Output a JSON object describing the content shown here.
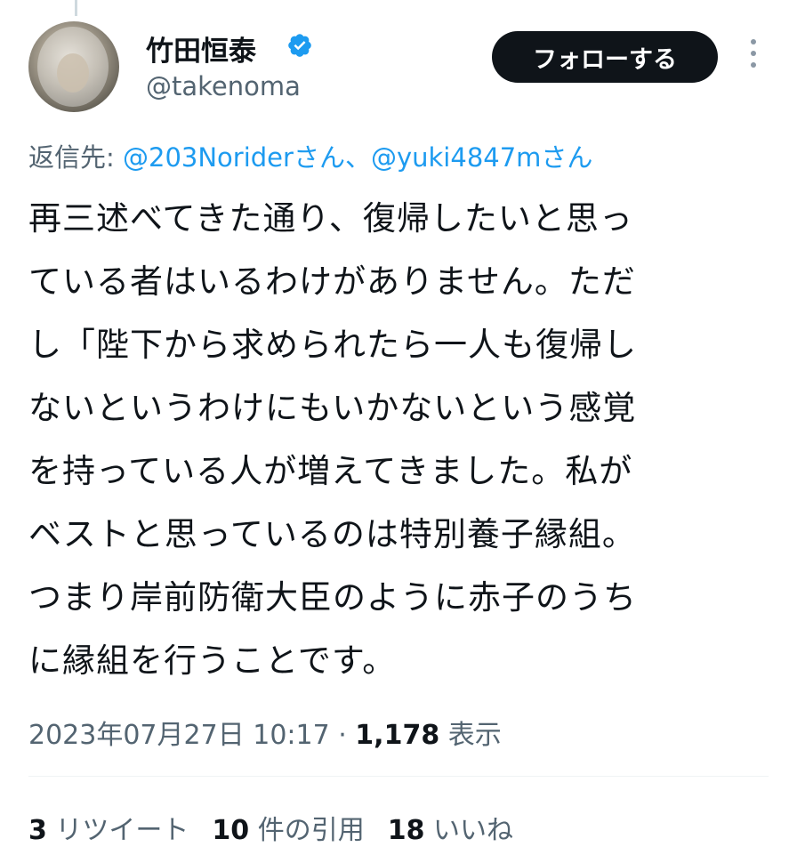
{
  "author": {
    "display_name": "竹田恒泰",
    "handle": "@takenoma",
    "verified": true
  },
  "follow_button_label": "フォローする",
  "reply_to": {
    "prefix": "返信先: ",
    "mention1": "@203Norider",
    "suffix1": "さん、",
    "mention2": "@yuki4847m",
    "suffix2": "さん"
  },
  "tweet_lines": [
    "再三述べてきた通り、復帰したいと思っ",
    "ている者はいるわけがありません。ただ",
    "し「陛下から求められたら一人も復帰し",
    "ないというわけにもいかないという感覚",
    "を持っている人が増えてきました。私が",
    "ベストと思っているのは特別養子縁組。",
    "つまり岸前防衛大臣のように赤子のうち",
    "に縁組を行うことです。"
  ],
  "meta": {
    "timestamp": "2023年07月27日 10:17",
    "separator": " · ",
    "views_count": "1,178",
    "views_label": " 表示"
  },
  "stats": {
    "retweets_count": "3",
    "retweets_label": " リツイート",
    "quotes_count": "10",
    "quotes_label": " 件の引用",
    "likes_count": "18",
    "likes_label": " いいね"
  },
  "colors": {
    "verified_blue": "#1d9bf0",
    "mention_blue": "#1d9bf0",
    "secondary_text": "#536471",
    "button_bg": "#0f1419"
  }
}
